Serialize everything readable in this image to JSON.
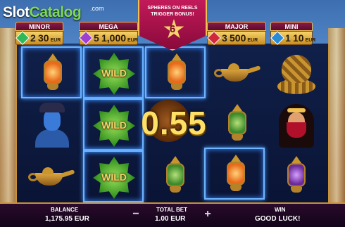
{
  "logo": {
    "part1": "Slot",
    "part2": "Catalog",
    "suffix": ".com"
  },
  "banner": {
    "line1": "SPHERES ON REELS",
    "line2": "TRIGGER BONUS!",
    "count": "6"
  },
  "jackpots": [
    {
      "name": "MINOR",
      "count": "2",
      "value": "30",
      "currency": "EUR",
      "gem_color": "#2fb85a"
    },
    {
      "name": "MEGA",
      "count": "5",
      "value": "1,000",
      "currency": "EUR",
      "gem_color": "#a040d0"
    },
    {
      "name": "MAJOR",
      "count": "3",
      "value": "500",
      "currency": "EUR",
      "gem_color": "#d02a3a"
    },
    {
      "name": "MINI",
      "count": "1",
      "value": "10",
      "currency": "EUR",
      "gem_color": "#2a8ad8"
    }
  ],
  "win_amount": "0.55",
  "symbols": {
    "wild": "WILD"
  },
  "bottom_bar": {
    "balance_label": "BALANCE",
    "balance_value": "1,175.95 EUR",
    "minus": "−",
    "total_bet_label": "TOTAL BET",
    "total_bet_value": "1.00 EUR",
    "plus": "+",
    "win_label": "WIN",
    "win_value": "GOOD LUCK!"
  },
  "colors": {
    "accent_gold": "#f6d36a",
    "lock_frame": "#6fb4ff",
    "banner": "#c21a5a"
  }
}
